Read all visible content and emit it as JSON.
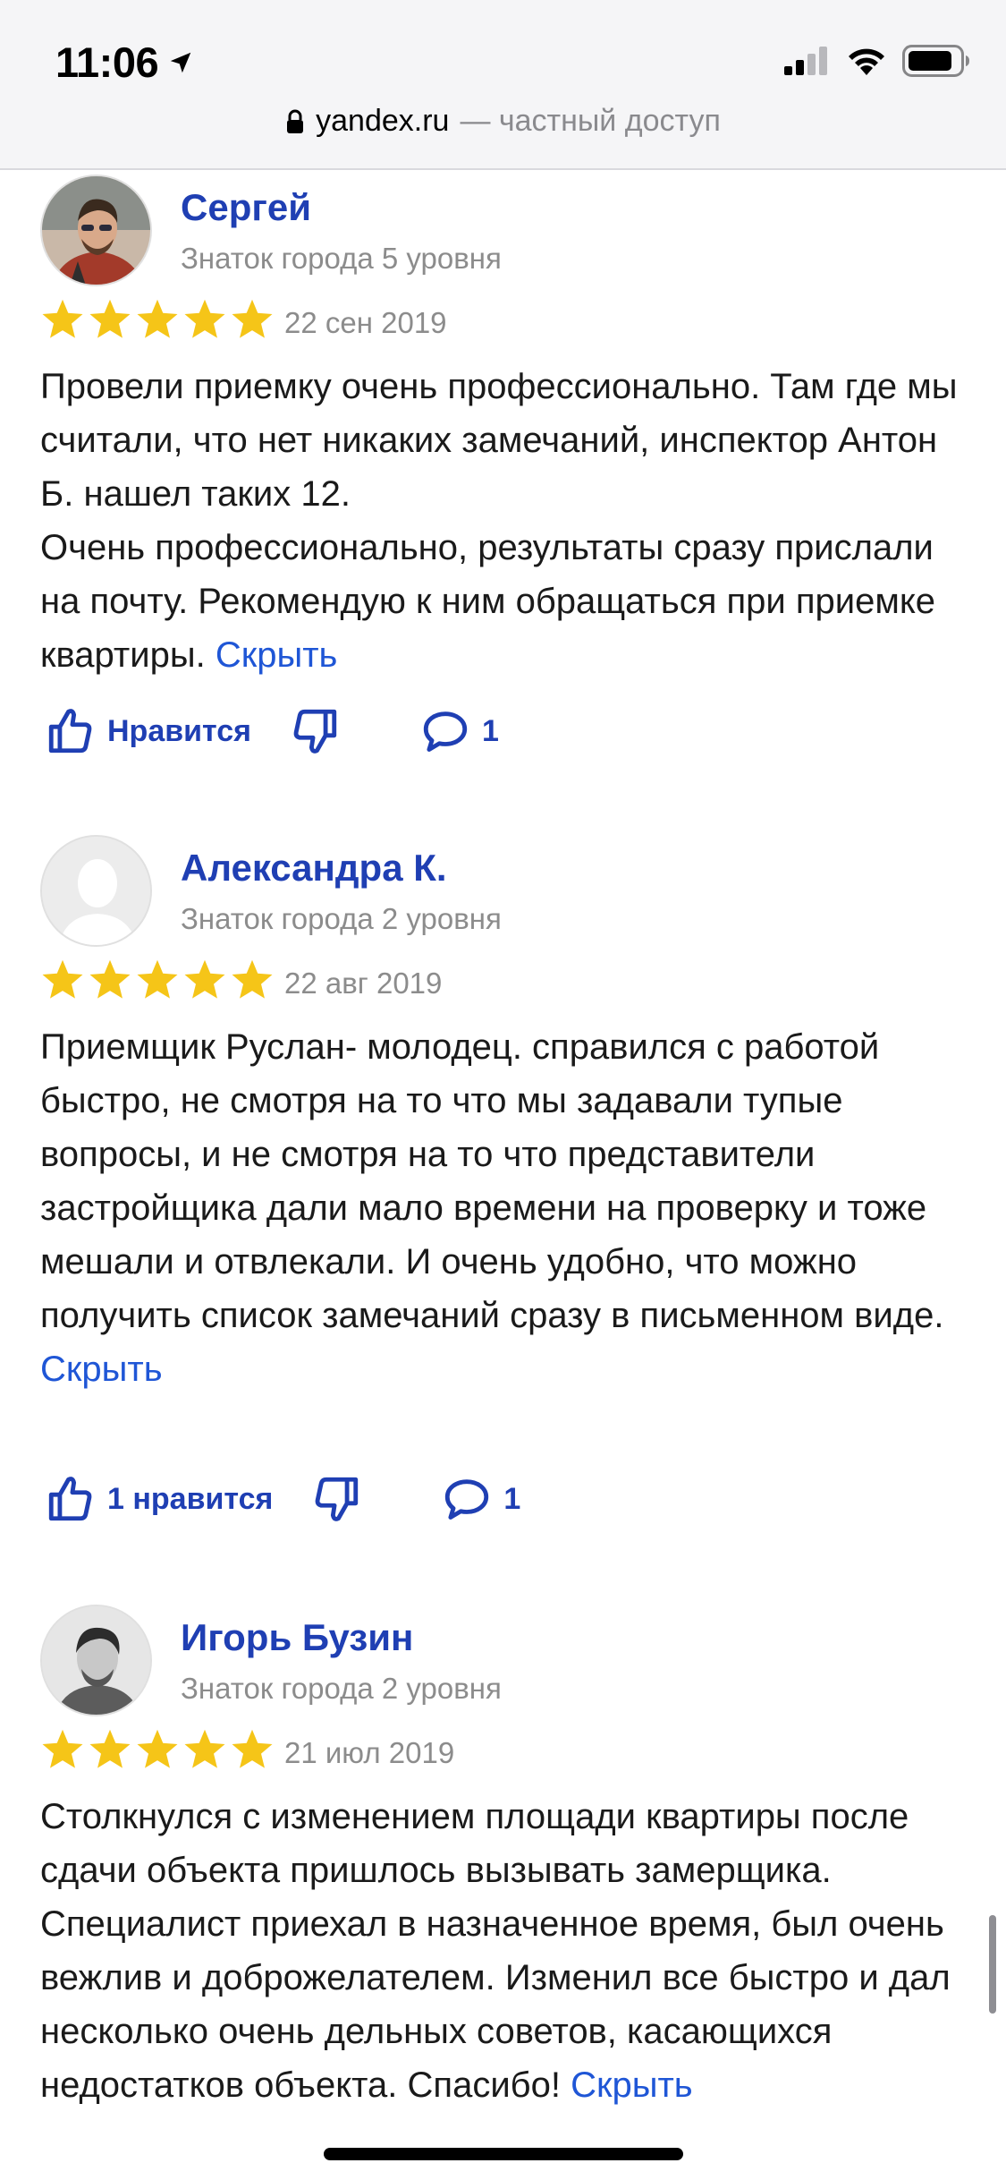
{
  "status_bar": {
    "time": "11:06"
  },
  "url_bar": {
    "domain": "yandex.ru",
    "suffix": "— частный доступ"
  },
  "colors": {
    "link": "#1f56d6",
    "name": "#1f3fb3",
    "star": "#f5c518",
    "meta": "#8c8c8c"
  },
  "reviews": [
    {
      "author": "Сергей",
      "level": "Знаток города 5 уровня",
      "rating": 5,
      "date": "22 сен 2019",
      "text": "Провели приемку очень профессионально. Там где мы считали, что нет никаких замечаний, инспектор Антон Б. нашел таких 12.\nОчень профессионально, результаты сразу прислали на почту. Рекомендую к ним обращаться при приемке квартиры.",
      "hide_label": "Скрыть",
      "like_label": "Нравится",
      "comments": "1"
    },
    {
      "author": "Александра К.",
      "level": "Знаток города 2 уровня",
      "rating": 5,
      "date": "22 авг 2019",
      "text": "Приемщик Руслан- молодец. справился с работой быстро, не смотря на то что мы задавали тупые вопросы, и не смотря на то что представители застройщика дали мало времени на проверку и тоже мешали и отвлекали. И очень удобно, что можно получить список замечаний сразу в письменном виде.",
      "hide_label": "Скрыть",
      "like_label": "1 нравится",
      "comments": "1"
    },
    {
      "author": "Игорь Бузин",
      "level": "Знаток города 2 уровня",
      "rating": 5,
      "date": "21 июл 2019",
      "text": "Столкнулся с изменением площади квартиры после сдачи объекта пришлось вызывать замерщика. Специалист приехал в назначенное время, был очень вежлив и доброжелателем. Изменил все быстро и дал несколько очень дельных советов, касающихся недостатков объекта. Спасибо!",
      "hide_label": "Скрыть"
    }
  ]
}
